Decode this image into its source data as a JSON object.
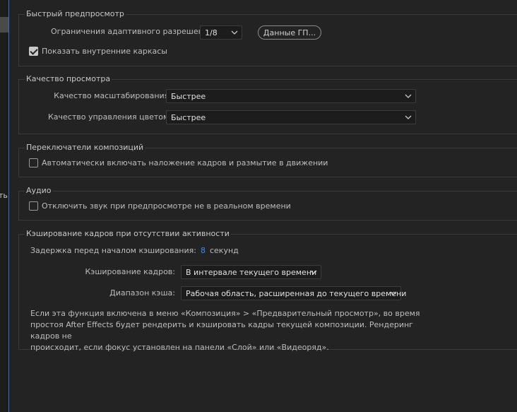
{
  "sidebar": {
    "partial_label": "ть"
  },
  "quick_preview": {
    "title": "Быстрый предпросмотр",
    "adaptive_label": "Ограничения адаптивного разрешения:",
    "adaptive_value": "1/8",
    "gpu_button": "Данные ГП...",
    "show_wireframes_label": "Показать внутренние каркасы",
    "show_wireframes_checked": true
  },
  "viewer_quality": {
    "title": "Качество просмотра",
    "zoom_label": "Качество масштабирования:",
    "zoom_value": "Быстрее",
    "color_label": "Качество управления цветом:",
    "color_value": "Быстрее"
  },
  "comp_switches": {
    "title": "Переключатели композиций",
    "auto_enable_label": "Автоматически включать наложение кадров и размытие в движении",
    "auto_enable_checked": false
  },
  "audio": {
    "title": "Аудио",
    "mute_label": "Отключить звук при предпросмотре не в реальном времени",
    "mute_checked": false
  },
  "cache_idle": {
    "title": "Кэширование кадров при отсутствии активности",
    "delay_label": "Задержка перед началом кэширования:",
    "delay_value": "8",
    "delay_unit": "секунд",
    "frames_label": "Кэширование кадров:",
    "frames_value": "В интервале текущего времени",
    "range_label": "Диапазон кэша:",
    "range_value": "Рабочая область, расширенная до текущего времени",
    "note_line1": "Если эта функция включена в меню «Композиция» > «Предварительный просмотр», во время",
    "note_line2": "простоя After Effects будет рендерить и кэшировать кадры текущей композиции. Рендеринг кадров не",
    "note_line3": "происходит, если фокус установлен на панели «Слой» или «Видеоряд»."
  },
  "colors": {
    "accent": "#3a8ff0",
    "background": "#232323"
  }
}
